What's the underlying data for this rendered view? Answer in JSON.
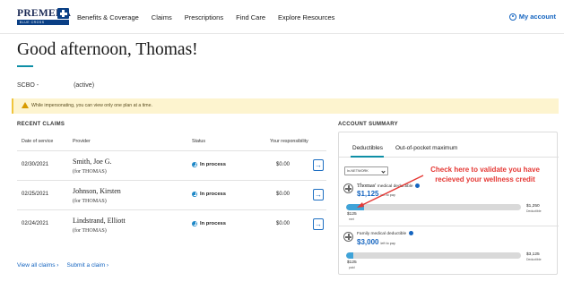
{
  "nav": {
    "logo_word": "PREMERA",
    "logo_sub": "BLUE CROSS",
    "links": [
      "Benefits & Coverage",
      "Claims",
      "Prescriptions",
      "Find Care",
      "Explore Resources"
    ],
    "my_account": "My account"
  },
  "greeting": {
    "prefix": "Good afternoon,",
    "name": "Thomas!"
  },
  "plan": {
    "code": "SCBO -",
    "status": "(active)"
  },
  "banner": {
    "text": "While impersonating, you can view only one plan at a time."
  },
  "claims": {
    "title": "RECENT CLAIMS",
    "headers": {
      "date": "Date of service",
      "provider": "Provider",
      "status": "Status",
      "responsibility": "Your responsibility"
    },
    "rows": [
      {
        "date": "02/30/2021",
        "provider": "Smith, Joe G.",
        "for": "(for THOMAS)",
        "status": "In process",
        "amount": "$0.00"
      },
      {
        "date": "02/25/2021",
        "provider": "Johnson, Kirsten",
        "for": "(for THOMAS)",
        "status": "In process",
        "amount": "$0.00"
      },
      {
        "date": "02/24/2021",
        "provider": "Lindstrand, Elliott",
        "for": "(for THOMAS)",
        "status": "In process",
        "amount": "$0.00"
      }
    ],
    "go_glyph": "→",
    "view_all": "View all claims ›",
    "submit": "Submit a claim ›"
  },
  "summary": {
    "title": "ACCOUNT SUMMARY",
    "tabs": [
      "Deductibles",
      "Out-of-pocket maximum"
    ],
    "select_value": "In-NETWORK",
    "individual": {
      "name": "Thomas'",
      "label": "medical deductible",
      "amount": "$1,125",
      "amount_sub": "left to pay",
      "met": "$125",
      "met_caption": "met",
      "total": "$1,250",
      "total_caption": "Deductible",
      "met_fraction": 0.1
    },
    "family": {
      "label": "Family medical deductible",
      "amount": "$3,000",
      "amount_sub": "left to pay",
      "met": "$125",
      "met_caption": "paid",
      "total": "$3,125",
      "total_caption": "Deductible",
      "met_fraction": 0.04
    }
  },
  "annotation": {
    "text": "Check here to validate you have recieved your wellness credit",
    "color": "#e53935"
  }
}
